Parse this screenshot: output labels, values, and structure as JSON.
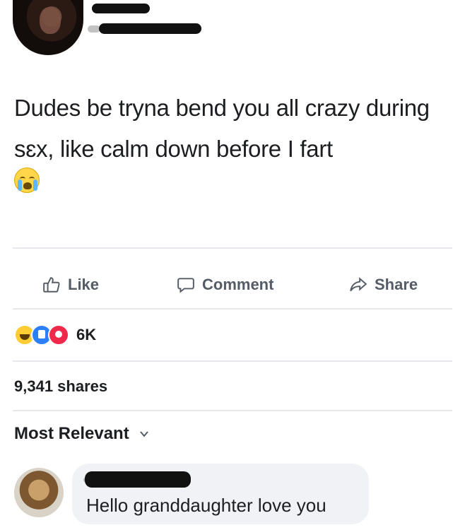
{
  "post": {
    "text": "Dudes be tryna bend you all crazy during sɛx, like calm down before I fart",
    "emoji": "sob-emoji"
  },
  "actions": {
    "like": "Like",
    "comment": "Comment",
    "share": "Share"
  },
  "reactions": {
    "types": [
      "haha",
      "like",
      "love"
    ],
    "count": "6K"
  },
  "shares": "9,341 shares",
  "comments": {
    "sort_label": "Most Relevant",
    "items": [
      {
        "text": "Hello granddaughter love you"
      }
    ]
  },
  "colors": {
    "text": "#1c1e21",
    "muted": "#555c66",
    "divider": "#e6e7ea",
    "bubble": "#f0f2f5",
    "like_blue": "#2d7ff9",
    "love_red": "#f0284a",
    "haha_yellow": "#ffcc33"
  }
}
